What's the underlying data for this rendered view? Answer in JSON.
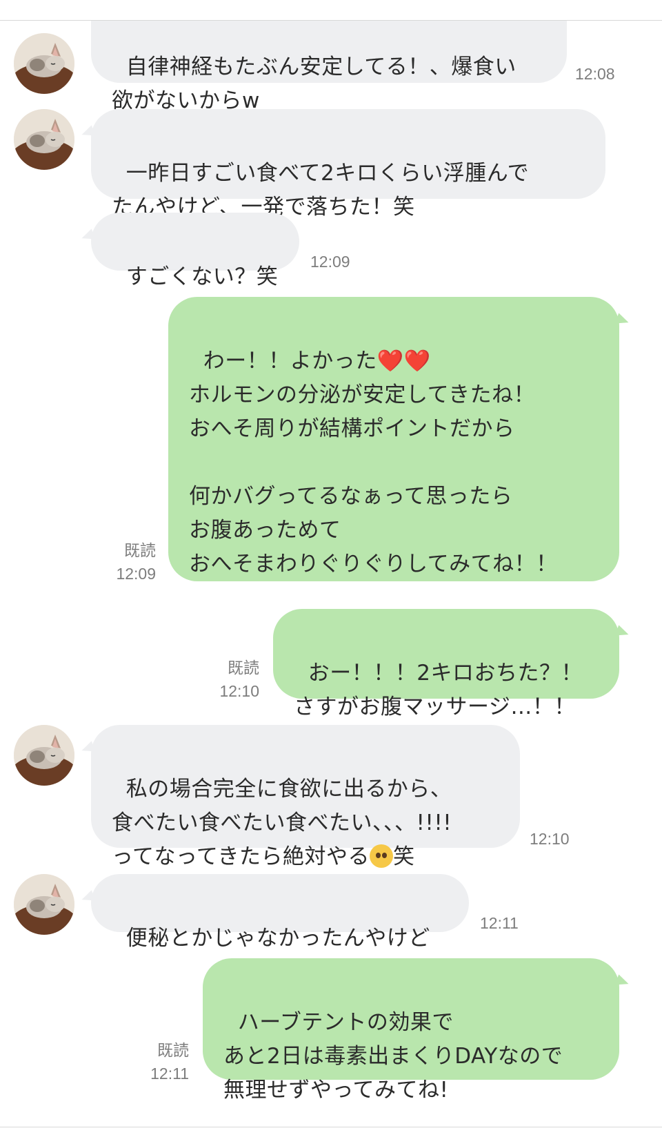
{
  "contact": {
    "avatar_icon": "cat-avatar-icon"
  },
  "messages": [
    {
      "id": "m1",
      "direction": "in",
      "text": "自律神経もたぶん安定してる！、爆食い\n欲がないからw",
      "time": "12:08"
    },
    {
      "id": "m2",
      "direction": "in",
      "text": "一昨日すごい食べて2キロくらい浮腫んで\nたんやけど、一発で落ちた！笑"
    },
    {
      "id": "m3",
      "direction": "in",
      "text": "すごくない？笑",
      "time": "12:09"
    },
    {
      "id": "m4",
      "direction": "out",
      "text_line1": "わー！！よかった",
      "text_rest": "\nホルモンの分泌が安定してきたね！\nおへそ周りが結構ポイントだから\n\n何かバグってるなぁって思ったら\nお腹あっためて\nおへそまわりぐりぐりしてみてね！！",
      "emoji": "❤️❤️",
      "read": "既読",
      "time": "12:09"
    },
    {
      "id": "m5",
      "direction": "out",
      "text": "おー！！！2キロおちた？！\nさすがお腹マッサージ…！！",
      "read": "既読",
      "time": "12:10"
    },
    {
      "id": "m6",
      "direction": "in",
      "text_a": "私の場合完全に食欲に出るから、\n食べたい食べたい食べたい、、、!!!!\nってなってきたら絶対やる",
      "emoji_icon": "pleading-face-emoji-icon",
      "text_b": "笑",
      "time": "12:10"
    },
    {
      "id": "m7",
      "direction": "in",
      "text": "便秘とかじゃなかったんやけど",
      "time": "12:11"
    },
    {
      "id": "m8",
      "direction": "out",
      "text": "ハーブテントの効果で\nあと2日は毒素出まくりDAYなので\n無理せずやってみてね!",
      "read": "既読",
      "time": "12:11"
    }
  ],
  "colors": {
    "incoming_bubble": "#eeeff1",
    "outgoing_bubble": "#b9e6ad",
    "timestamp": "#7d7d7d"
  }
}
